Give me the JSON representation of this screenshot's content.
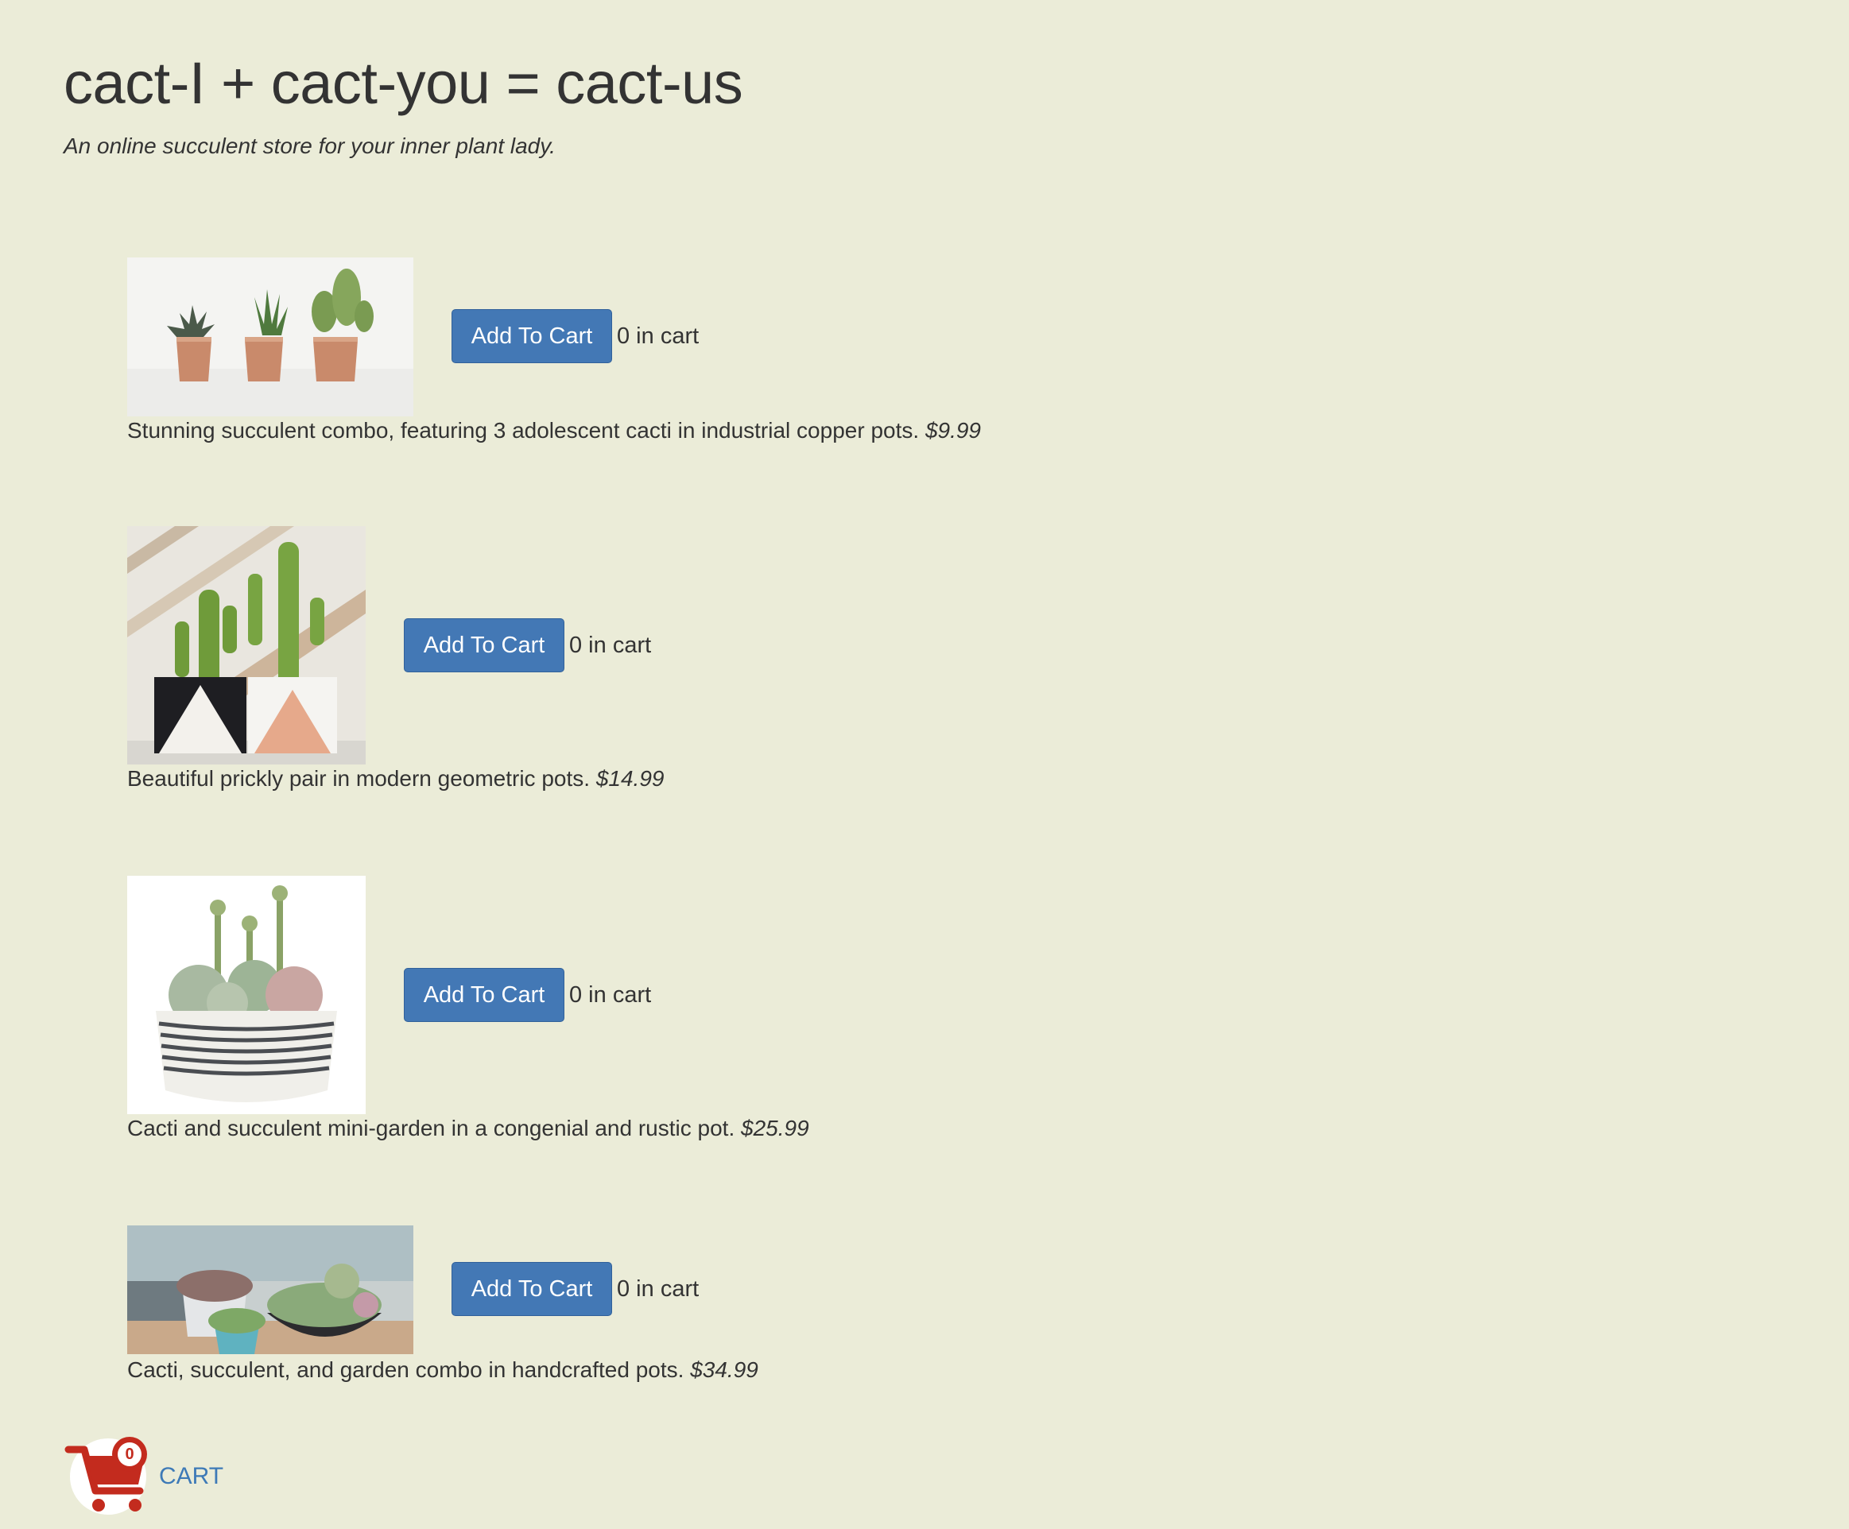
{
  "header": {
    "title": "cact-I + cact-you = cact-us",
    "subtitle": "An online succulent store for your inner plant lady."
  },
  "products": [
    {
      "image_icon": "copper-pots-cacti-photo",
      "button_label": "Add To Cart",
      "cart_count": "0 in cart",
      "description": "Stunning succulent combo, featuring 3 adolescent cacti in industrial copper pots.",
      "price": "$9.99"
    },
    {
      "image_icon": "geometric-pots-cacti-photo",
      "button_label": "Add To Cart",
      "cart_count": "0 in cart",
      "description": "Beautiful prickly pair in modern geometric pots.",
      "price": "$14.99"
    },
    {
      "image_icon": "succulent-bowl-photo",
      "button_label": "Add To Cart",
      "cart_count": "0 in cart",
      "description": "Cacti and succulent mini-garden in a congenial and rustic pot.",
      "price": "$25.99"
    },
    {
      "image_icon": "handcrafted-pots-garden-photo",
      "button_label": "Add To Cart",
      "cart_count": "0 in cart",
      "description": "Cacti, succulent, and garden combo in handcrafted pots.",
      "price": "$34.99"
    }
  ],
  "cart": {
    "icon": "shopping-cart-icon",
    "badge_count": "0",
    "link_label": "CART"
  },
  "colors": {
    "background": "#ebecd8",
    "button": "#4378b5",
    "cart_icon": "#c32b1e",
    "link": "#3e7ab7"
  }
}
